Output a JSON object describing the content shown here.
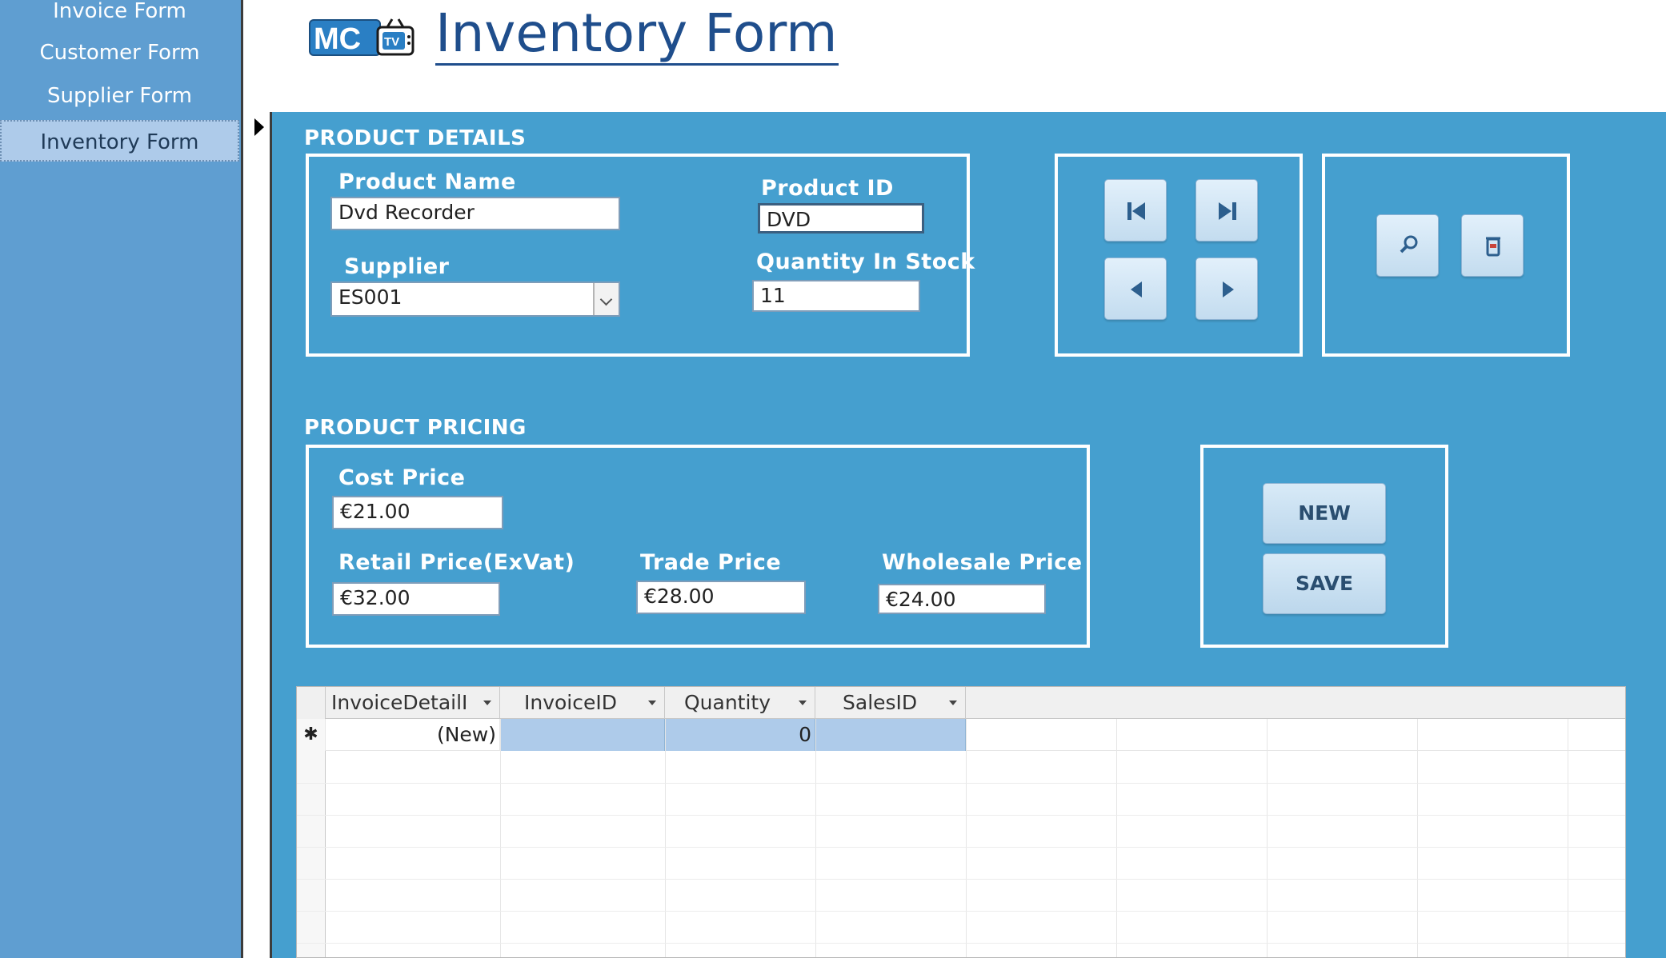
{
  "nav": {
    "items": [
      {
        "label": "Invoice Form",
        "active": false
      },
      {
        "label": "Customer Form",
        "active": false
      },
      {
        "label": "Supplier Form",
        "active": false
      },
      {
        "label": "Inventory Form",
        "active": true
      }
    ]
  },
  "header": {
    "logo_icon": "mctv-logo",
    "title": "Inventory Form"
  },
  "product_details": {
    "heading": "PRODUCT DETAILS",
    "product_name_label": "Product Name",
    "product_name_value": "Dvd Recorder",
    "product_id_label": "Product ID",
    "product_id_value": "DVD",
    "supplier_label": "Supplier",
    "supplier_value": "ES001",
    "quantity_label": "Quantity In Stock",
    "quantity_value": "11"
  },
  "record_nav": {
    "first_icon": "first-record-icon",
    "last_icon": "last-record-icon",
    "previous_icon": "previous-record-icon",
    "next_icon": "next-record-icon",
    "find_icon": "search-icon",
    "delete_icon": "delete-icon"
  },
  "product_pricing": {
    "heading": "PRODUCT PRICING",
    "cost_price_label": "Cost Price",
    "cost_price_value": "€21.00",
    "retail_price_label": "Retail Price(ExVat)",
    "retail_price_value": "€32.00",
    "trade_price_label": "Trade Price",
    "trade_price_value": "€28.00",
    "wholesale_price_label": "Wholesale Price",
    "wholesale_price_value": "€24.00"
  },
  "commands": {
    "new_label": "NEW",
    "save_label": "SAVE"
  },
  "datasheet": {
    "columns": [
      "InvoiceDetailI",
      "InvoiceID",
      "Quantity",
      "SalesID"
    ],
    "new_row": {
      "marker": "✱",
      "invoice_detail_id": "(New)",
      "invoice_id": "",
      "quantity": "0",
      "sales_id": ""
    }
  },
  "colors": {
    "nav_background": "#5f9ed1",
    "form_background": "#459fcf",
    "title_color": "#1f4e8c",
    "selection": "#aecbea"
  }
}
